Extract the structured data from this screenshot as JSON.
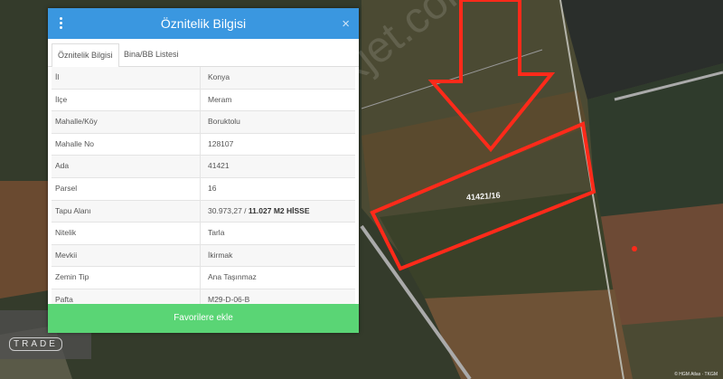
{
  "panel": {
    "title": "Öznitelik Bilgisi",
    "close_symbol": "×",
    "tabs": [
      {
        "label": "Öznitelik Bilgisi"
      },
      {
        "label": "Bina/BB Listesi"
      }
    ],
    "rows": [
      {
        "key": "İl",
        "value": "Konya"
      },
      {
        "key": "İlçe",
        "value": "Meram"
      },
      {
        "key": "Mahalle/Köy",
        "value": "Boruktolu"
      },
      {
        "key": "Mahalle No",
        "value": "128107"
      },
      {
        "key": "Ada",
        "value": "41421"
      },
      {
        "key": "Parsel",
        "value": "16"
      },
      {
        "key": "Tapu Alanı",
        "value": "30.973,27 /",
        "value_bold": "11.027 M2 HİSSE"
      },
      {
        "key": "Nitelik",
        "value": "Tarla"
      },
      {
        "key": "Mevkii",
        "value": "İkirmak"
      },
      {
        "key": "Zemin Tip",
        "value": "Ana Taşınmaz"
      },
      {
        "key": "Pafta",
        "value": "M29-D-06-B"
      }
    ],
    "favorite_button": "Favorilere ekle"
  },
  "map": {
    "parcel_label": "41421/16",
    "watermark": "emlakjet.com",
    "logo_text": "TRADE",
    "attribution": "© HGM Atlas · TKGM"
  },
  "colors": {
    "header": "#3a97e0",
    "favorite": "#5ad575",
    "highlight": "#ff2a1a"
  }
}
